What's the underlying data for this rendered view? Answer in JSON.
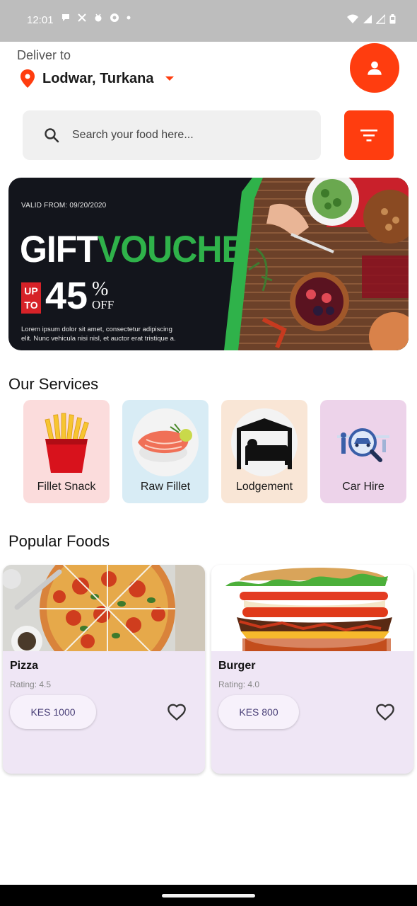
{
  "status_bar": {
    "time": "12:01",
    "icons_left": [
      "chat-bubble-icon",
      "x-logo-icon",
      "android-debug-icon",
      "shield-icon",
      "dot-icon"
    ],
    "icons_right": [
      "wifi-icon",
      "signal-icon",
      "signal-icon",
      "battery-icon"
    ]
  },
  "header": {
    "deliver_label": "Deliver to",
    "location": "Lodwar, Turkana"
  },
  "search": {
    "placeholder": "Search your food here..."
  },
  "banner": {
    "valid_from": "VALID FROM: 09/20/2020",
    "title_gift": "GIFT",
    "title_voucher": "VOUCHER",
    "upto_line1": "UP",
    "upto_line2": "TO",
    "percent": "45",
    "percent_sign": "%",
    "off": "OFF",
    "description": "Lorem ipsum dolor sit amet, consectetur adipiscing elit. Nunc vehicula nisi nisl, et auctor erat tristique a."
  },
  "services": {
    "title": "Our Services",
    "items": [
      {
        "label": "Fillet Snack",
        "bg": "#fbdcdc"
      },
      {
        "label": "Raw Fillet",
        "bg": "#d8ecf5"
      },
      {
        "label": "Lodgement",
        "bg": "#f9e6d6"
      },
      {
        "label": "Car Hire",
        "bg": "#edd3ea"
      }
    ]
  },
  "popular": {
    "title": "Popular Foods",
    "items": [
      {
        "name": "Pizza",
        "rating": "Rating: 4.5",
        "price": "KES 1000"
      },
      {
        "name": "Burger",
        "rating": "Rating: 4.0",
        "price": "KES 800"
      }
    ]
  },
  "colors": {
    "accent": "#ff3d0f",
    "card_bg": "#efe6f5",
    "voucher_green": "#2fb24a"
  }
}
